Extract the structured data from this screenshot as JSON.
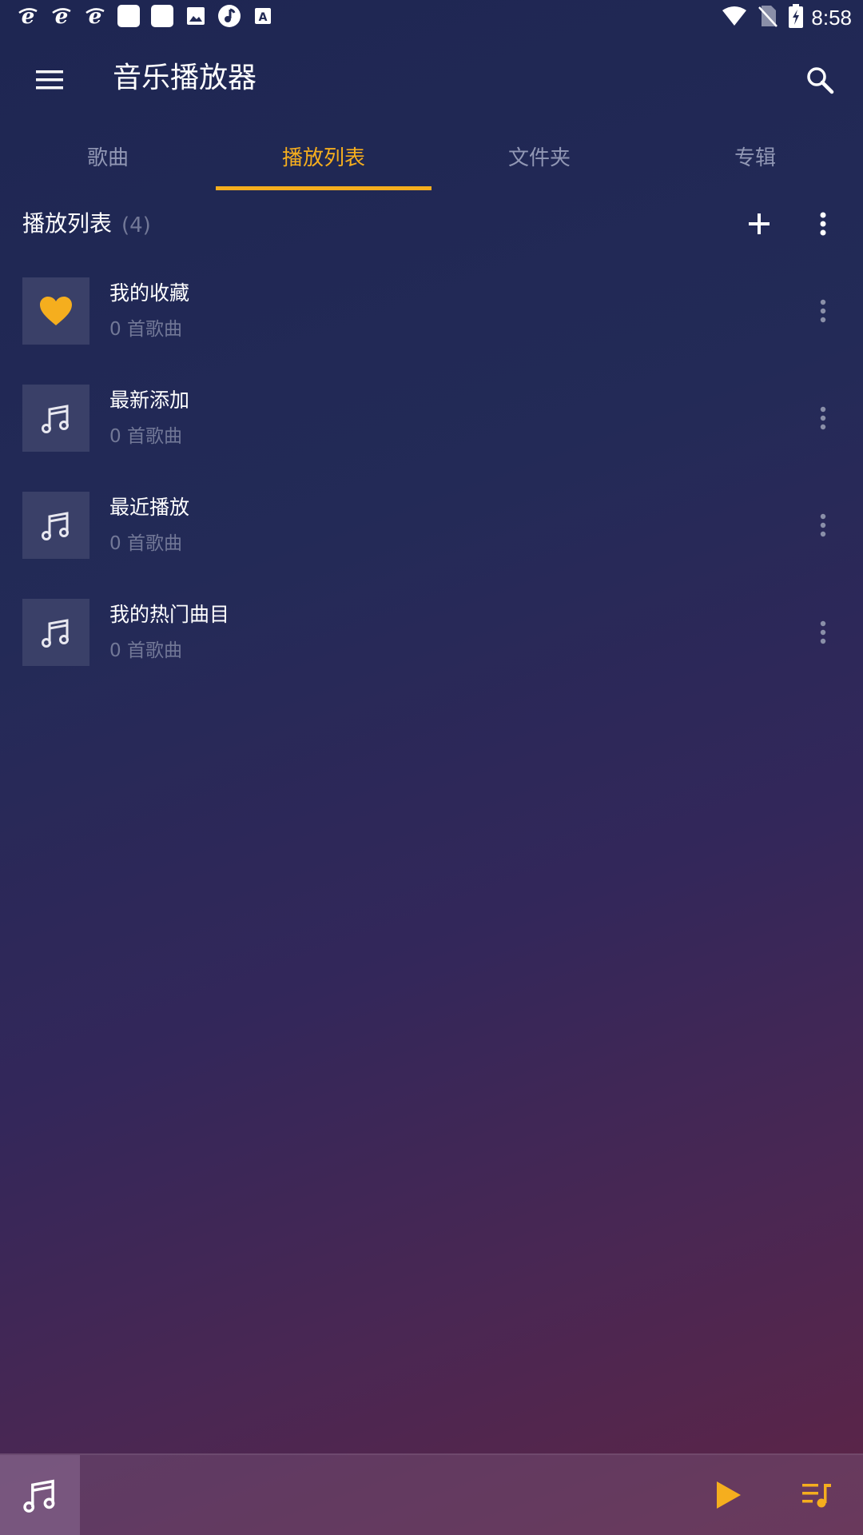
{
  "status_bar": {
    "time": "8:58",
    "left_icons": [
      "ie-icon",
      "ie-icon",
      "ie-icon",
      "app-square-icon",
      "app-square-icon",
      "gallery-icon",
      "music-note-icon",
      "text-a-icon"
    ],
    "right_icons": [
      "wifi-icon",
      "no-sim-icon",
      "battery-charging-icon"
    ]
  },
  "app_bar": {
    "title": "音乐播放器"
  },
  "tabs": [
    {
      "label": "歌曲",
      "active": false
    },
    {
      "label": "播放列表",
      "active": true
    },
    {
      "label": "文件夹",
      "active": false
    },
    {
      "label": "专辑",
      "active": false
    }
  ],
  "section": {
    "title": "播放列表",
    "count": "(4)"
  },
  "playlists": [
    {
      "title": "我的收藏",
      "subtitle": "0 首歌曲",
      "icon": "heart-icon"
    },
    {
      "title": "最新添加",
      "subtitle": "0 首歌曲",
      "icon": "music-note-icon"
    },
    {
      "title": "最近播放",
      "subtitle": "0 首歌曲",
      "icon": "music-note-icon"
    },
    {
      "title": "我的热门曲目",
      "subtitle": "0 首歌曲",
      "icon": "music-note-icon"
    }
  ],
  "colors": {
    "accent": "#f5ae1e",
    "inactive_tab": "#9197b4",
    "secondary_text": "#727897",
    "thumb_bg": "#3a4068"
  }
}
